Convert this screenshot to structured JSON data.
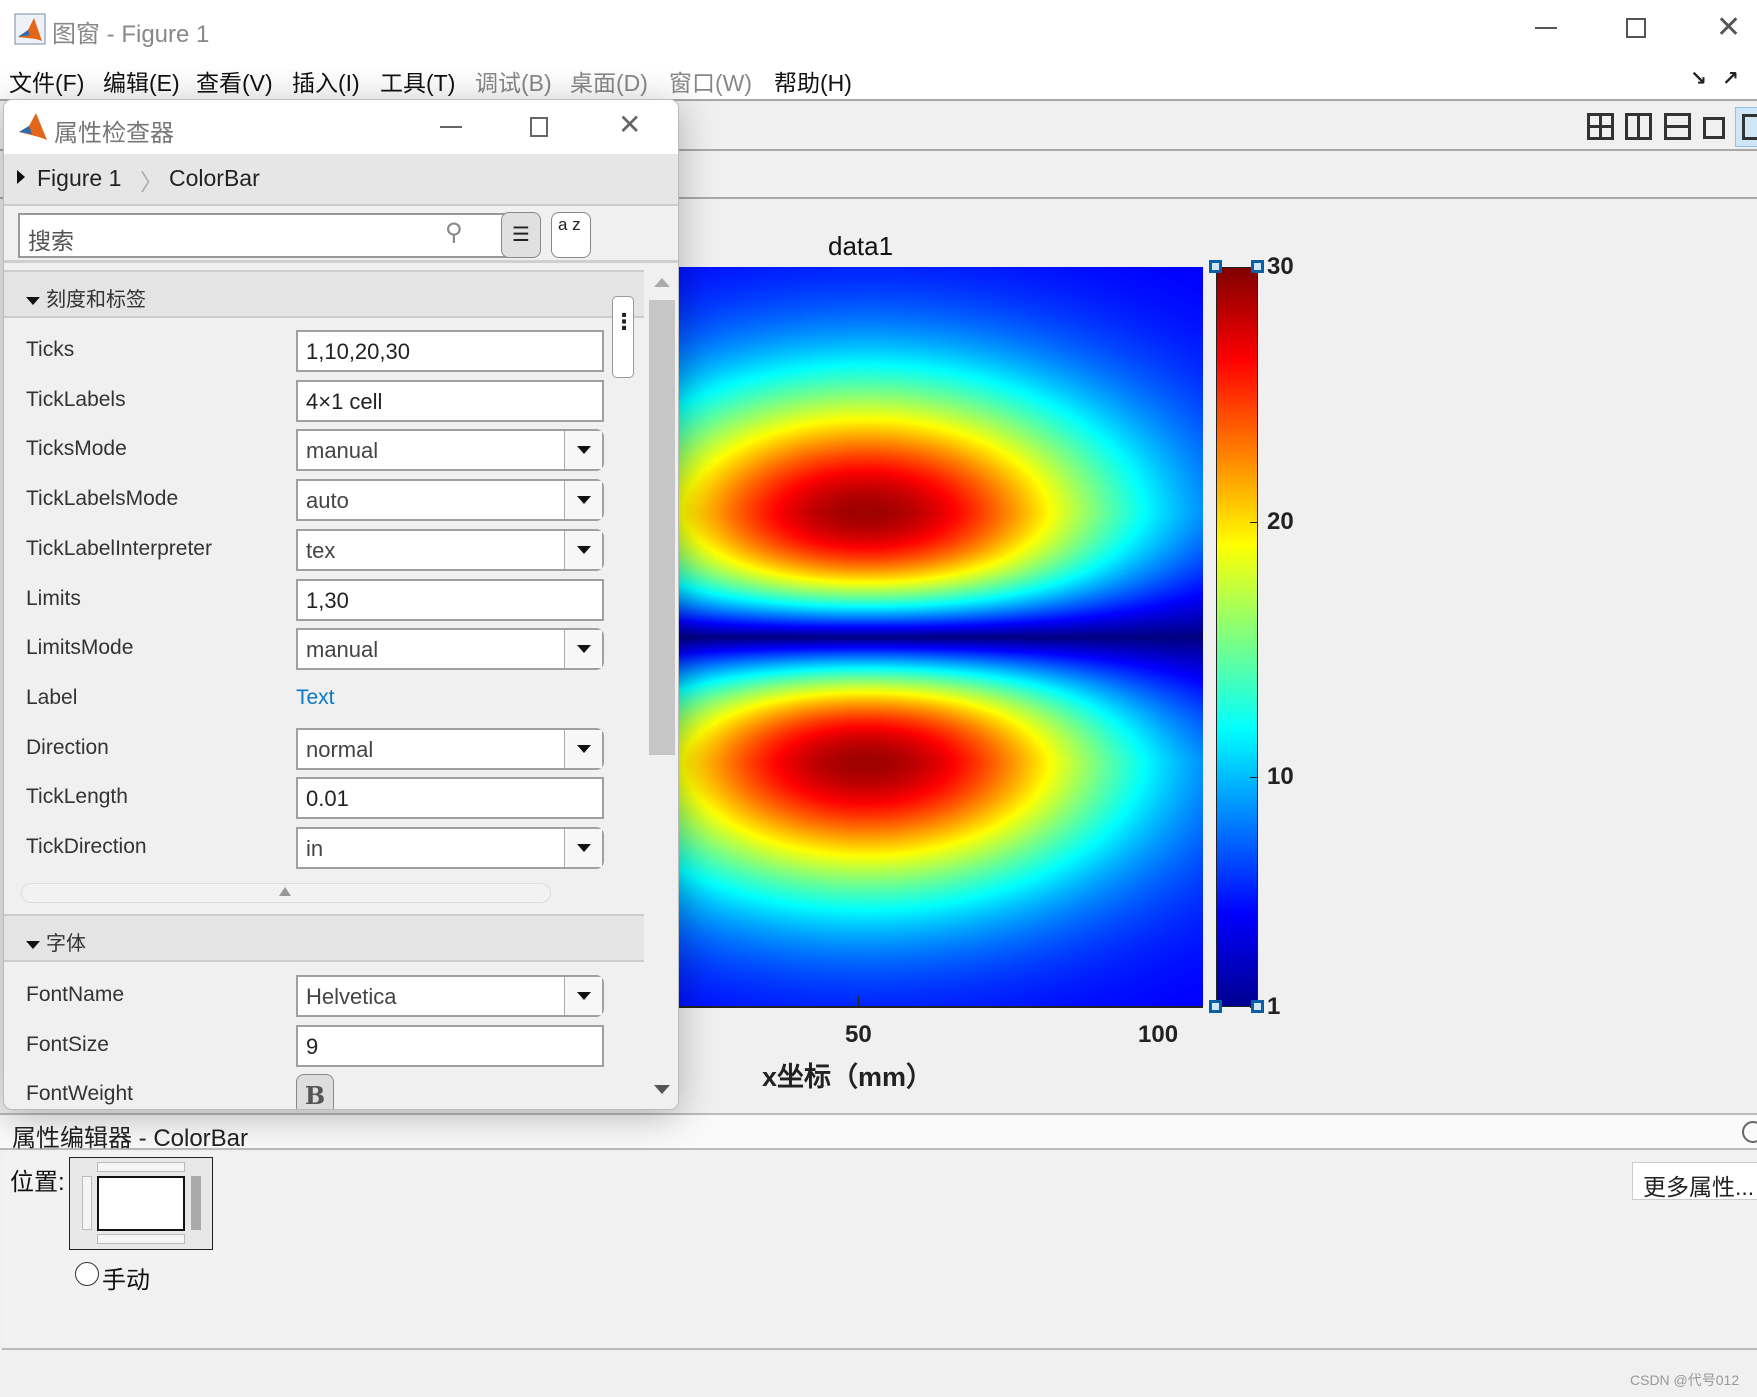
{
  "window": {
    "title": "图窗 - Figure 1"
  },
  "menu": [
    {
      "label": "文件(F)",
      "enabled": true
    },
    {
      "label": "编辑(E)",
      "enabled": true
    },
    {
      "label": "查看(V)",
      "enabled": true
    },
    {
      "label": "插入(I)",
      "enabled": true
    },
    {
      "label": "工具(T)",
      "enabled": true
    },
    {
      "label": "调试(B)",
      "enabled": false
    },
    {
      "label": "桌面(D)",
      "enabled": false
    },
    {
      "label": "窗口(W)",
      "enabled": false
    },
    {
      "label": "帮助(H)",
      "enabled": true
    }
  ],
  "inspector": {
    "title": "属性检查器",
    "breadcrumb": {
      "parent": "Figure 1",
      "current": "ColorBar"
    },
    "search_placeholder": "搜索",
    "sort_button": "a z",
    "sections": [
      {
        "title": "刻度和标签",
        "rows": [
          {
            "label": "Ticks",
            "value": "1,10,20,30",
            "kind": "text"
          },
          {
            "label": "TickLabels",
            "value": "4×1 cell",
            "kind": "text"
          },
          {
            "label": "TicksMode",
            "value": "manual",
            "kind": "dropdown"
          },
          {
            "label": "TickLabelsMode",
            "value": "auto",
            "kind": "dropdown"
          },
          {
            "label": "TickLabelInterpreter",
            "value": "tex",
            "kind": "dropdown"
          },
          {
            "label": "Limits",
            "value": "1,30",
            "kind": "text"
          },
          {
            "label": "LimitsMode",
            "value": "manual",
            "kind": "dropdown"
          },
          {
            "label": "Label",
            "value": "Text",
            "kind": "link"
          },
          {
            "label": "Direction",
            "value": "normal",
            "kind": "dropdown"
          },
          {
            "label": "TickLength",
            "value": "0.01",
            "kind": "text"
          },
          {
            "label": "TickDirection",
            "value": "in",
            "kind": "dropdown"
          }
        ]
      },
      {
        "title": "字体",
        "rows": [
          {
            "label": "FontName",
            "value": "Helvetica",
            "kind": "dropdown"
          },
          {
            "label": "FontSize",
            "value": "9",
            "kind": "text"
          },
          {
            "label": "FontWeight",
            "value": "B",
            "kind": "toggle"
          }
        ]
      }
    ]
  },
  "chart_data": {
    "type": "heatmap",
    "title": "data1",
    "xlabel": "x坐标（mm）",
    "xticks": [
      50,
      100
    ],
    "colormap": "jet",
    "colorbar": {
      "ticks": [
        1,
        10,
        20,
        30
      ],
      "limits": [
        1,
        30
      ],
      "selected": true
    },
    "description_of_values": "two red peaks (~30) at x≈51 above and below a dark-blue (~1) horizontal band at mid-height"
  },
  "colors": {
    "accent": "#0a78c8",
    "selection": "#0b5fa5"
  },
  "bottom": {
    "header": "属性编辑器 - ColorBar",
    "position_label": "位置:",
    "manual_label": "手动",
    "more_props": "更多属性..."
  },
  "watermark": "CSDN @代号012"
}
